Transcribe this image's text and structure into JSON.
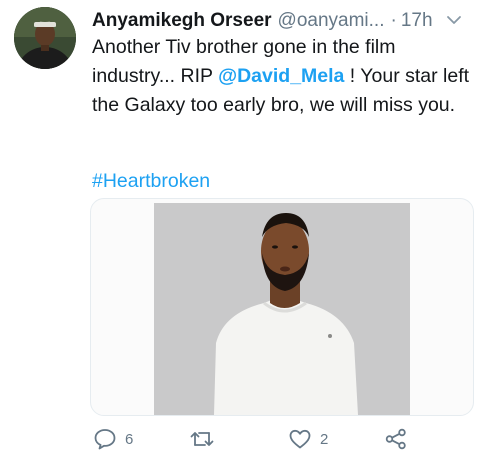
{
  "tweet": {
    "display_name": "Anyamikegh Orseer",
    "handle": "@oanyami...",
    "separator": "·",
    "time": "17h",
    "text_part1": "Another Tiv brother gone in the film industry... RIP ",
    "mention": "@David_Mela",
    "text_part2": " ! Your star left the Galaxy too early bro, we will miss you.",
    "hashtag": "#Heartbroken"
  },
  "actions": {
    "reply_count": "6",
    "like_count": "2"
  },
  "icons": {
    "caret": "chevron-down-icon",
    "reply": "reply-icon",
    "retweet": "retweet-icon",
    "like": "heart-icon",
    "share": "share-icon"
  },
  "colors": {
    "link": "#1da1f2",
    "secondary_text": "#657786",
    "border": "#e6ecf0"
  }
}
